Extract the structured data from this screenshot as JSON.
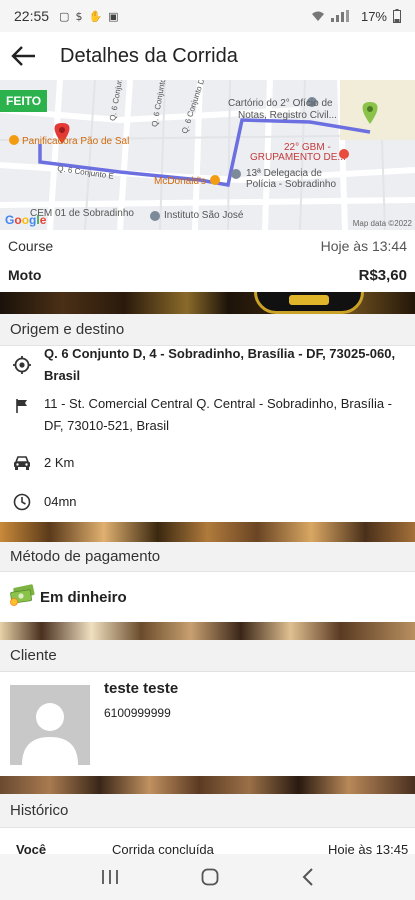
{
  "status_bar": {
    "time": "22:55",
    "battery": "17%"
  },
  "header": {
    "title": "Detalhes da Corrida"
  },
  "map": {
    "status_badge": "FEITO",
    "labels": {
      "padaria": "Panificadora Pão de Sal",
      "mcdonalds": "McDonald's",
      "cartorio_1": "Cartório do 2° Ofício de",
      "cartorio_2": "Notas, Registro Civil...",
      "gbm_1": "22° GBM -",
      "gbm_2": "GRUPAMENTO DE...",
      "delegacia_1": "13ª Delegacia de",
      "delegacia_2": "Polícia - Sobradinho",
      "cem": "CEM 01 de Sobradinho",
      "instituto": "Instituto São José",
      "street_1": "Q. 6 Conjunto 5",
      "street_2": "Q. 6 Conjunto 6",
      "street_3": "Q. 6 Conjunto D",
      "street_4": "Q. 6 Conjunto E"
    },
    "google": "Google",
    "map_data": "Map data ©2022"
  },
  "ride": {
    "type_label": "Course",
    "date": "Hoje às 13:44",
    "vehicle": "Moto",
    "price": "R$3,60"
  },
  "route": {
    "section_title": "Origem e destino",
    "origin": "Q. 6 Conjunto D, 4 - Sobradinho, Brasília - DF, 73025-060, Brasil",
    "destination": "11 - St. Comercial Central Q. Central - Sobradinho, Brasília - DF, 73010-521, Brasil",
    "distance": "2 Km",
    "duration": "04mn"
  },
  "payment": {
    "section_title": "Método de pagamento",
    "method": "Em dinheiro"
  },
  "client": {
    "section_title": "Cliente",
    "name": "teste teste",
    "phone": "6100999999"
  },
  "history": {
    "section_title": "Histórico",
    "rows": [
      {
        "who": "Você",
        "event": "Corrida concluída",
        "time": "Hoje às 13:45"
      }
    ]
  },
  "colors": {
    "route_line": "#6b6fe0",
    "badge": "#2bb24c",
    "origin_pin": "#e53935",
    "destination_pin": "#7cb342"
  }
}
